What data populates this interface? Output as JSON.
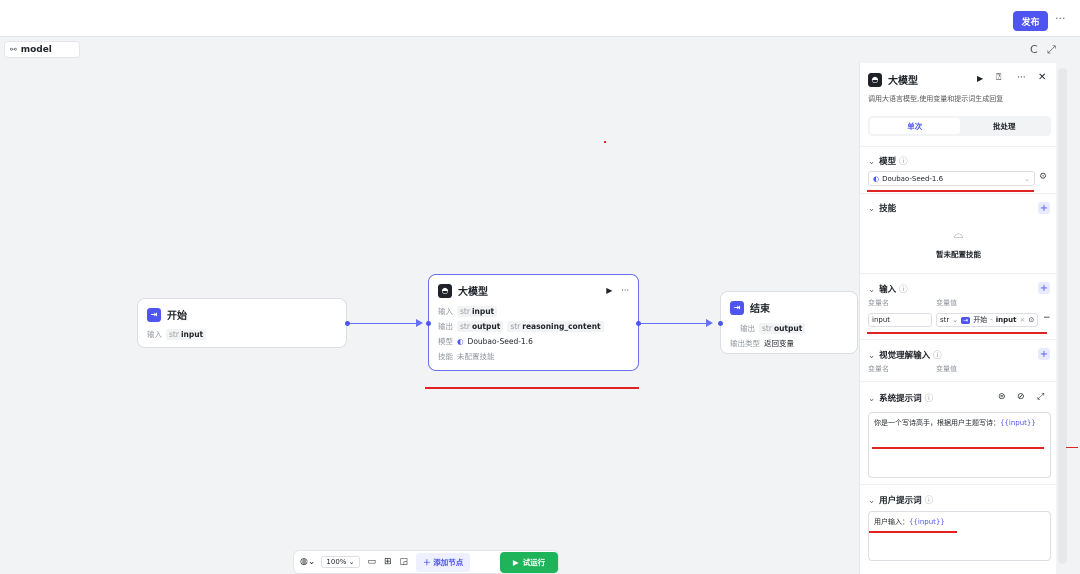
{
  "topbar": {
    "publish_label": "发布",
    "more_label": "···"
  },
  "canvas": {
    "tab_label": "model",
    "refresh_icon": "C",
    "expand_icon": "⤢"
  },
  "nodes": {
    "start": {
      "title": "开始",
      "input_label": "输入",
      "input_type": "str",
      "input_name": "input"
    },
    "llm": {
      "title": "大模型",
      "run_icon": "▶",
      "more": "···",
      "input_label": "输入",
      "input_type": "str",
      "input_name": "input",
      "output_label": "输出",
      "output_type1": "str",
      "output_name1": "output",
      "output_type2": "str",
      "output_name2": "reasoning_content",
      "model_label": "模型",
      "model_name": "Doubao-Seed-1.6",
      "skill_label": "技能",
      "skill_value": "未配置技能"
    },
    "end": {
      "title": "结束",
      "output_label": "输出",
      "output_type": "str",
      "output_name": "output",
      "output_kind_label": "输出类型",
      "output_kind_value": "返回变量"
    }
  },
  "panel": {
    "title": "大模型",
    "description": "调用大语言模型,使用变量和提示词生成回复",
    "tabs": [
      "单次",
      "批处理"
    ],
    "model_section": {
      "title": "模型",
      "model_name": "Doubao-Seed-1.6"
    },
    "skill_section": {
      "title": "技能",
      "empty_text": "暂未配置技能"
    },
    "input_section": {
      "title": "输入",
      "col_name": "变量名",
      "col_value": "变量值",
      "var_name": "input",
      "var_type": "str",
      "ref_node": "开始",
      "ref_var": "input",
      "remove": "−"
    },
    "vision_section": {
      "title": "视觉理解输入",
      "col_name": "变量名",
      "col_value": "变量值"
    },
    "system_prompt": {
      "title": "系统提示词",
      "text": "你是一个写诗高手，根据用户主题写诗：",
      "var": "{{input}}"
    },
    "user_prompt": {
      "title": "用户提示词",
      "text": "用户输入：",
      "var": "{{input}}"
    }
  },
  "toolbar": {
    "zoom": "100%",
    "add_node": "添加节点",
    "run": "试运行"
  },
  "colors": {
    "accent": "#4e55f0",
    "run_green": "#1fb35a",
    "annotation_red": "#e02424"
  }
}
